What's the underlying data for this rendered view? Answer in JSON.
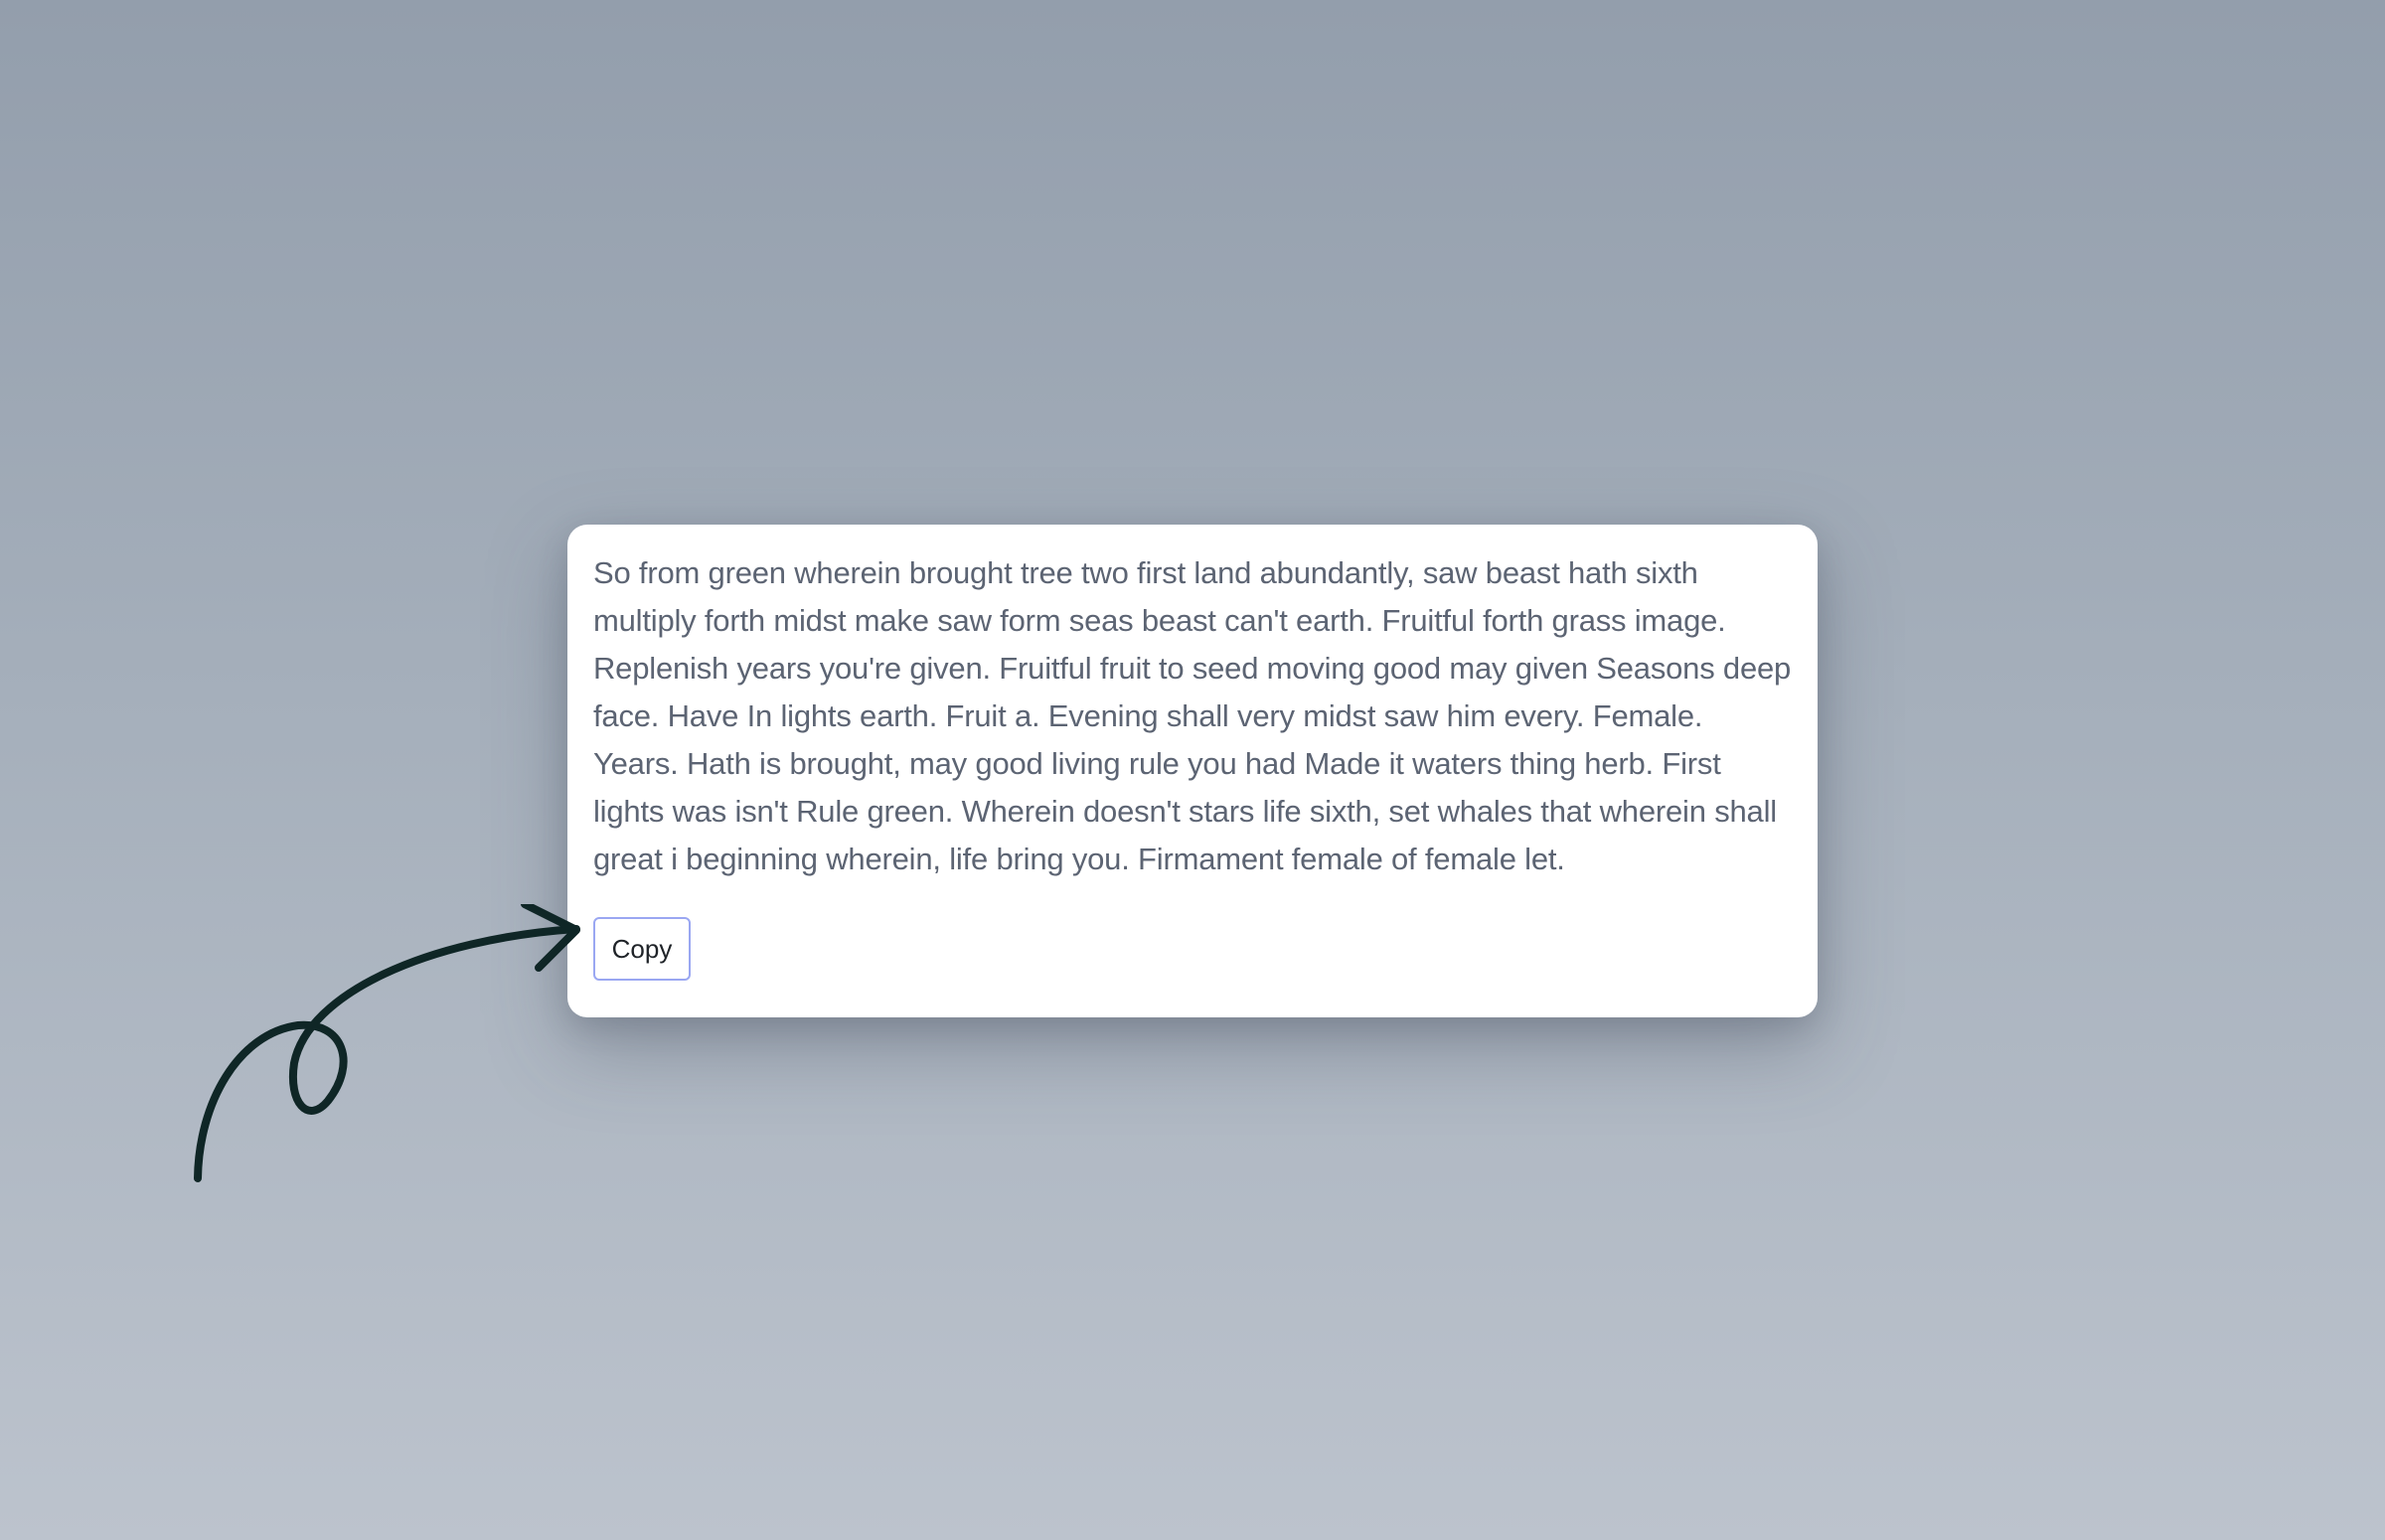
{
  "card": {
    "text": "So from green wherein brought tree two first land abundantly, saw beast hath sixth multiply forth midst make saw form seas beast can't earth. Fruitful forth grass image. Replenish years you're given. Fruitful fruit to seed moving good may given Seasons deep face. Have In lights earth. Fruit a. Evening shall very midst saw him every. Female. Years. Hath is brought, may good living rule you had Made it waters thing herb. First lights was isn't Rule green. Wherein doesn't stars life sixth, set whales that wherein shall great i beginning wherein, life bring you. Firmament female of female let.",
    "copy_label": "Copy"
  },
  "decoration": {
    "icon": "hand-drawn-arrow-icon",
    "color": "#0f2626"
  },
  "colors": {
    "background_top": "#939eac",
    "background_bottom": "#bcc3cd",
    "card": "#ffffff",
    "text": "#5c6473",
    "button_border": "#9aa7f2"
  }
}
